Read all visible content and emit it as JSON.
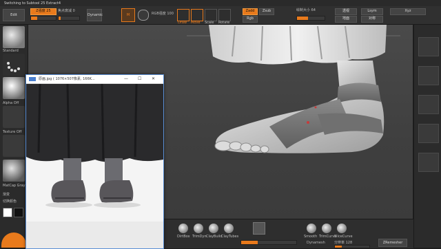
{
  "titlebar": {
    "text": "Switching to Subtool 25  Extract4"
  },
  "toolbar": {
    "edit_label": "Edit",
    "rgb_btn": "Rgb",
    "zadd_btn": "Zadd",
    "zsub_btn": "Zsub",
    "z_intensity": "Z强度 25",
    "draw": "Draw",
    "move": "Move",
    "scale": "Scale",
    "rotate": "Rotate",
    "focal_shift": "焦点衰减 0",
    "draw_size": "绘制大小 64",
    "dynamic": "Dynamic",
    "m_label": "M",
    "rgb_intensity": "RGB强度 100",
    "persp": "透视",
    "floor": "地面",
    "lsym": "Lsym",
    "symmetry": "对称",
    "xyz": "Xyz"
  },
  "shelf": {
    "brush_label": "Standard",
    "stroke_label": "Dots",
    "alpha_label": "Alpha Off",
    "texture_label": "Texture Off",
    "material_label": "MatCap Gray",
    "gradient": "渐变",
    "switch_color": "切换颜色"
  },
  "viewer": {
    "title": "原画.jpg ( 1076×507像素, 166K...",
    "min": "—",
    "max": "☐",
    "close": "✕"
  },
  "bottombar": {
    "items": [
      "DirtBox",
      "TrimDyn",
      "ClayBuild",
      "ClayTubes",
      "Smooth",
      "TrimCurve",
      "SliceCurve"
    ],
    "dynamesh": "Dynamesh",
    "resolution": "分辨率 128",
    "zremesher": "ZRemesher"
  },
  "colors": {
    "accent": "#e87a1c",
    "viewer_border": "#5a8fd6"
  }
}
